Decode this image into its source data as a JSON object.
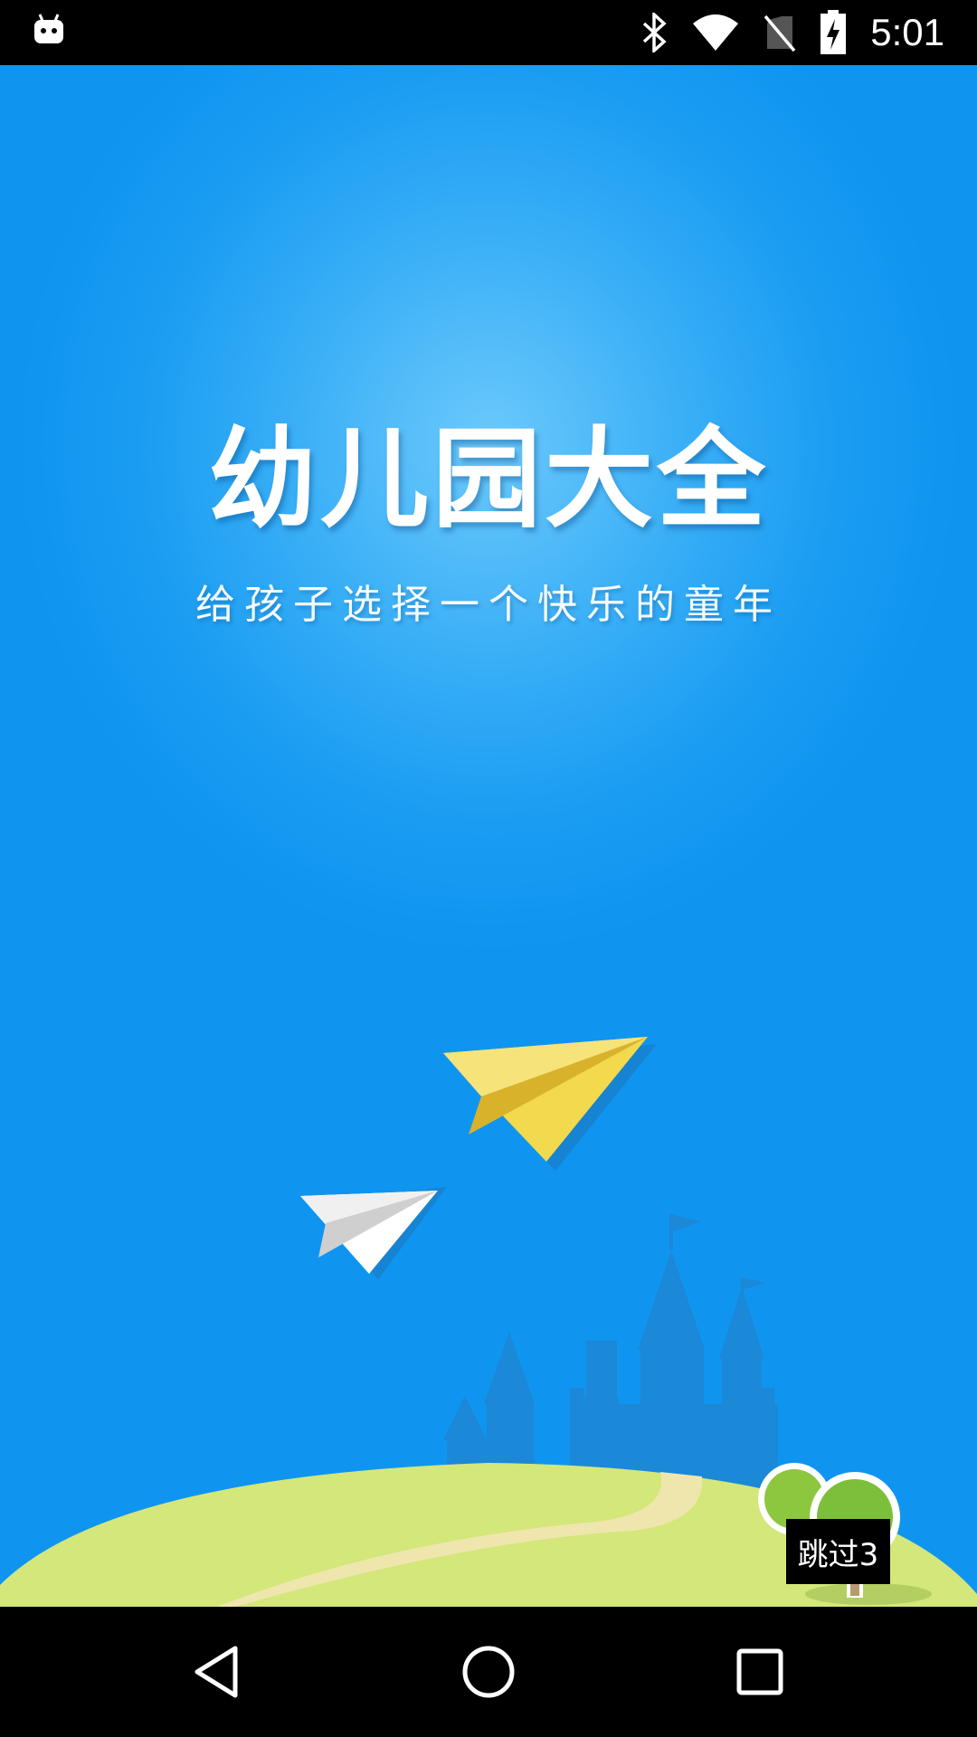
{
  "status_bar": {
    "time": "5:01",
    "icons": [
      "android-debug-icon",
      "bluetooth-icon",
      "wifi-icon",
      "no-sim-icon",
      "battery-charging-icon"
    ]
  },
  "splash": {
    "title": "幼儿园大全",
    "subtitle": "给孩子选择一个快乐的童年",
    "skip_label": "跳过3"
  },
  "nav_bar": {
    "icons": [
      "back-icon",
      "home-icon",
      "recents-icon"
    ]
  },
  "colors": {
    "sky_light": "#6cc9fb",
    "sky_dark": "#0f95f0",
    "hill": "#d4e77a",
    "path": "#efe6ae",
    "plane_yellow": "#f2d94e",
    "castle": "#1f86d4"
  }
}
